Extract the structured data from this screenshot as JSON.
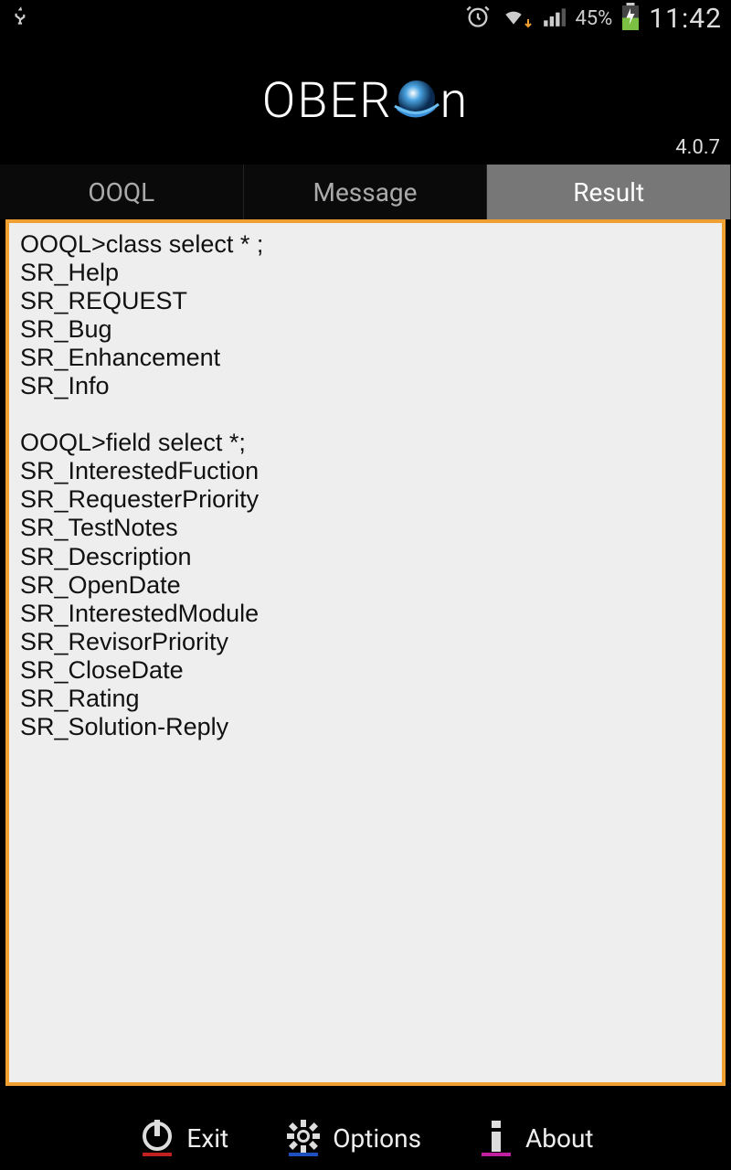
{
  "status_bar": {
    "battery_percent": "45%",
    "time": "11:42"
  },
  "header": {
    "logo_left": "OBER",
    "logo_right": "n",
    "version": "4.0.7"
  },
  "tabs": {
    "ooql": "OOQL",
    "message": "Message",
    "result": "Result",
    "active": "result"
  },
  "result": {
    "content": "OOQL>class select * ;\nSR_Help\nSR_REQUEST\nSR_Bug\nSR_Enhancement\nSR_Info\n\nOOQL>field select *;\nSR_InterestedFuction\nSR_RequesterPriority\nSR_TestNotes\nSR_Description\nSR_OpenDate\nSR_InterestedModule\nSR_RevisorPriority\nSR_CloseDate\nSR_Rating\nSR_Solution-Reply"
  },
  "bottom": {
    "exit": "Exit",
    "options": "Options",
    "about": "About"
  }
}
